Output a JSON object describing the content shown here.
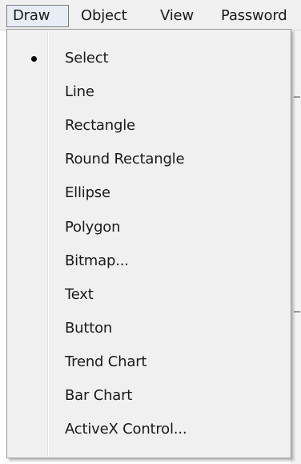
{
  "menubar": {
    "items": [
      {
        "label": "Draw",
        "active": true
      },
      {
        "label": "Object",
        "active": false
      },
      {
        "label": "View",
        "active": false
      },
      {
        "label": "Password",
        "active": false
      }
    ]
  },
  "draw_menu": {
    "items": [
      {
        "label": "Select",
        "checked": true
      },
      {
        "label": "Line",
        "checked": false
      },
      {
        "label": "Rectangle",
        "checked": false
      },
      {
        "label": "Round Rectangle",
        "checked": false
      },
      {
        "label": "Ellipse",
        "checked": false
      },
      {
        "label": "Polygon",
        "checked": false
      },
      {
        "label": "Bitmap...",
        "checked": false
      },
      {
        "label": "Text",
        "checked": false
      },
      {
        "label": "Button",
        "checked": false
      },
      {
        "label": "Trend Chart",
        "checked": false
      },
      {
        "label": "Bar Chart",
        "checked": false
      },
      {
        "label": "ActiveX Control...",
        "checked": false
      }
    ]
  },
  "colors": {
    "menu_background": "#f0f0f0",
    "active_menubar_item": "#e7ecf5",
    "menu_border": "#979797"
  },
  "icons": {
    "checked_indicator": "radio-dot-icon"
  }
}
